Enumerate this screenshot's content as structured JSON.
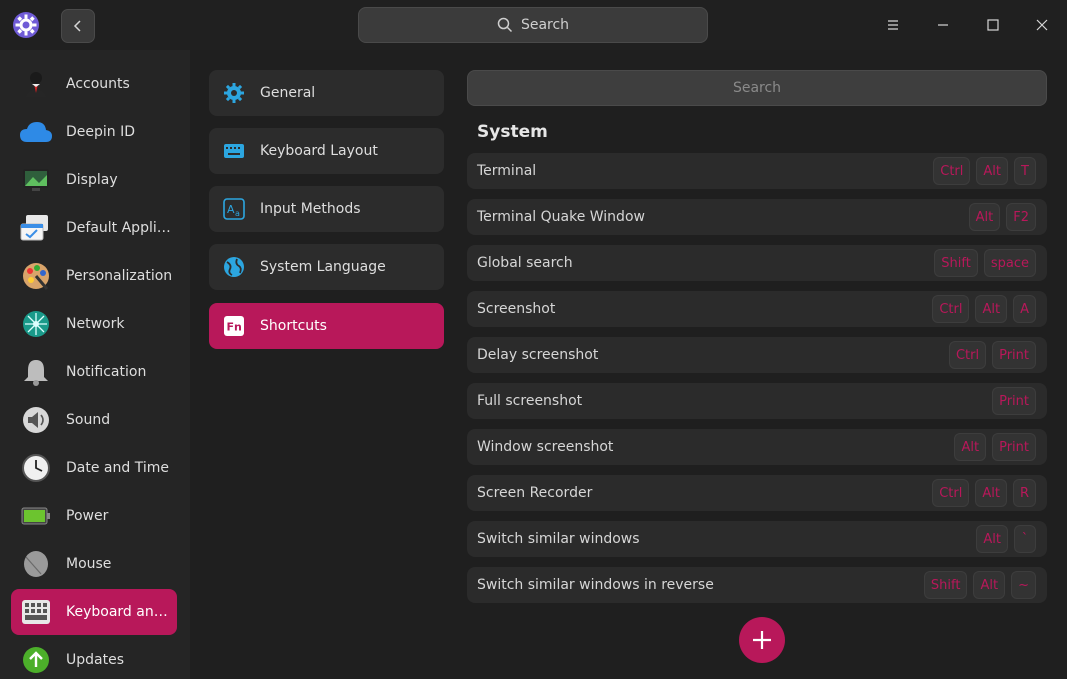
{
  "header": {
    "search_placeholder": "Search"
  },
  "sidebar": {
    "items": [
      {
        "label": "Accounts",
        "icon": "account-icon"
      },
      {
        "label": "Deepin ID",
        "icon": "cloud-icon"
      },
      {
        "label": "Display",
        "icon": "display-icon"
      },
      {
        "label": "Default Applic...",
        "icon": "default-apps-icon"
      },
      {
        "label": "Personalization",
        "icon": "palette-icon"
      },
      {
        "label": "Network",
        "icon": "network-icon"
      },
      {
        "label": "Notification",
        "icon": "bell-icon"
      },
      {
        "label": "Sound",
        "icon": "speaker-icon"
      },
      {
        "label": "Date and Time",
        "icon": "clock-icon"
      },
      {
        "label": "Power",
        "icon": "battery-icon"
      },
      {
        "label": "Mouse",
        "icon": "mouse-icon"
      },
      {
        "label": "Keyboard and ...",
        "icon": "keyboard-icon",
        "active": true
      },
      {
        "label": "Updates",
        "icon": "update-icon"
      }
    ]
  },
  "subnav": {
    "items": [
      {
        "label": "General",
        "icon": "gear-icon"
      },
      {
        "label": "Keyboard Layout",
        "icon": "keyboard-icon"
      },
      {
        "label": "Input Methods",
        "icon": "input-method-icon"
      },
      {
        "label": "System Language",
        "icon": "globe-icon"
      },
      {
        "label": "Shortcuts",
        "icon": "fn-key-icon",
        "active": true
      }
    ]
  },
  "content": {
    "search_placeholder": "Search",
    "section_title": "System",
    "shortcuts": [
      {
        "name": "Terminal",
        "keys": [
          "Ctrl",
          "Alt",
          "T"
        ]
      },
      {
        "name": "Terminal Quake Window",
        "keys": [
          "Alt",
          "F2"
        ]
      },
      {
        "name": "Global search",
        "keys": [
          "Shift",
          "space"
        ]
      },
      {
        "name": "Screenshot",
        "keys": [
          "Ctrl",
          "Alt",
          "A"
        ]
      },
      {
        "name": "Delay screenshot",
        "keys": [
          "Ctrl",
          "Print"
        ]
      },
      {
        "name": "Full screenshot",
        "keys": [
          "Print"
        ]
      },
      {
        "name": "Window screenshot",
        "keys": [
          "Alt",
          "Print"
        ]
      },
      {
        "name": "Screen Recorder",
        "keys": [
          "Ctrl",
          "Alt",
          "R"
        ]
      },
      {
        "name": "Switch similar windows",
        "keys": [
          "Alt",
          "`"
        ]
      },
      {
        "name": "Switch similar windows in reverse",
        "keys": [
          "Shift",
          "Alt",
          "~"
        ]
      }
    ]
  },
  "colors": {
    "accent": "#b8185a",
    "background": "#1f1f1f",
    "sidebar_bg": "#252525",
    "row_bg": "#2b2b2b"
  }
}
